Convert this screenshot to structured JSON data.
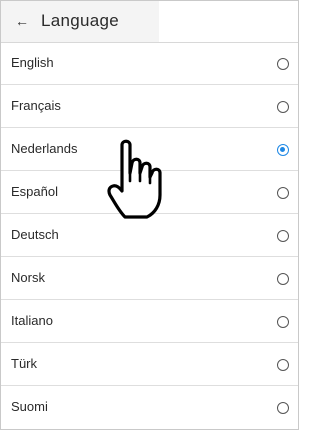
{
  "header": {
    "back_icon": "arrow-left-icon",
    "back_glyph": "←",
    "title": "Language"
  },
  "languages": [
    {
      "label": "English",
      "selected": false
    },
    {
      "label": "Français",
      "selected": false
    },
    {
      "label": "Nederlands",
      "selected": true
    },
    {
      "label": "Español",
      "selected": false
    },
    {
      "label": "Deutsch",
      "selected": false
    },
    {
      "label": "Norsk",
      "selected": false
    },
    {
      "label": "Italiano",
      "selected": false
    },
    {
      "label": "Türk",
      "selected": false
    },
    {
      "label": "Suomi",
      "selected": false
    }
  ],
  "colors": {
    "accent": "#1e88e5"
  },
  "overlay_icon": "pointing-hand-icon"
}
